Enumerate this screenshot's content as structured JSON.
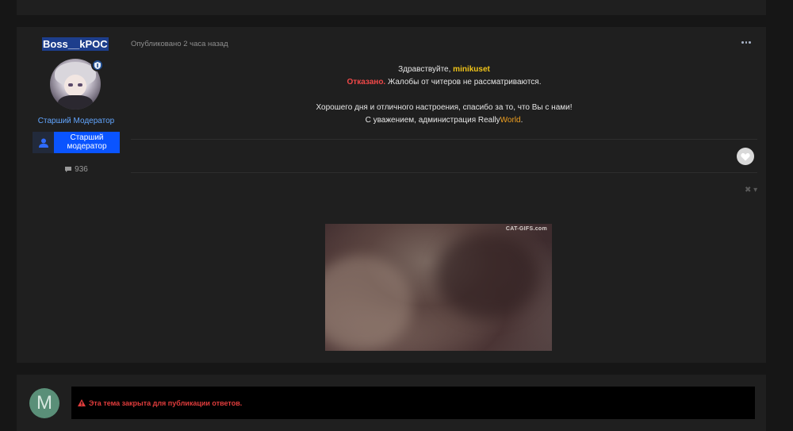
{
  "post": {
    "author": {
      "username": "Boss__kPOC",
      "role_title": "Старший Модератор",
      "role_badge_label": "Старший модератор",
      "post_count": "936",
      "avatar_icon": "avatar-anime-girl",
      "badge_icon": "moderator-shield-icon"
    },
    "meta": {
      "published": "Опубликовано 2 часа назад"
    },
    "content": {
      "greeting": "Здравствуйте,",
      "greeting_name": "minikuset",
      "denied_label": "Отказано.",
      "denied_text": " Жалобы от читеров не рассматриваются.",
      "closing_line": "Хорошего дня и отличного настроения, спасибо за то, что Вы с нами!",
      "signature_prefix": "С уважением, администрация Really",
      "signature_brand": "World",
      "signature_suffix": "."
    },
    "gif": {
      "watermark": "CAT-GIFS.com"
    },
    "colors": {
      "username_highlight": "#1d3e8c",
      "role_title": "#62a6ff",
      "role_badge": "#0a54ff",
      "denied": "#f04848",
      "name": "#f0c419",
      "brand": "#f0a020"
    }
  },
  "reply": {
    "avatar_letter": "M",
    "locked_message": "Эта тема закрыта для публикации ответов.",
    "locked_color": "#e03c3c"
  }
}
